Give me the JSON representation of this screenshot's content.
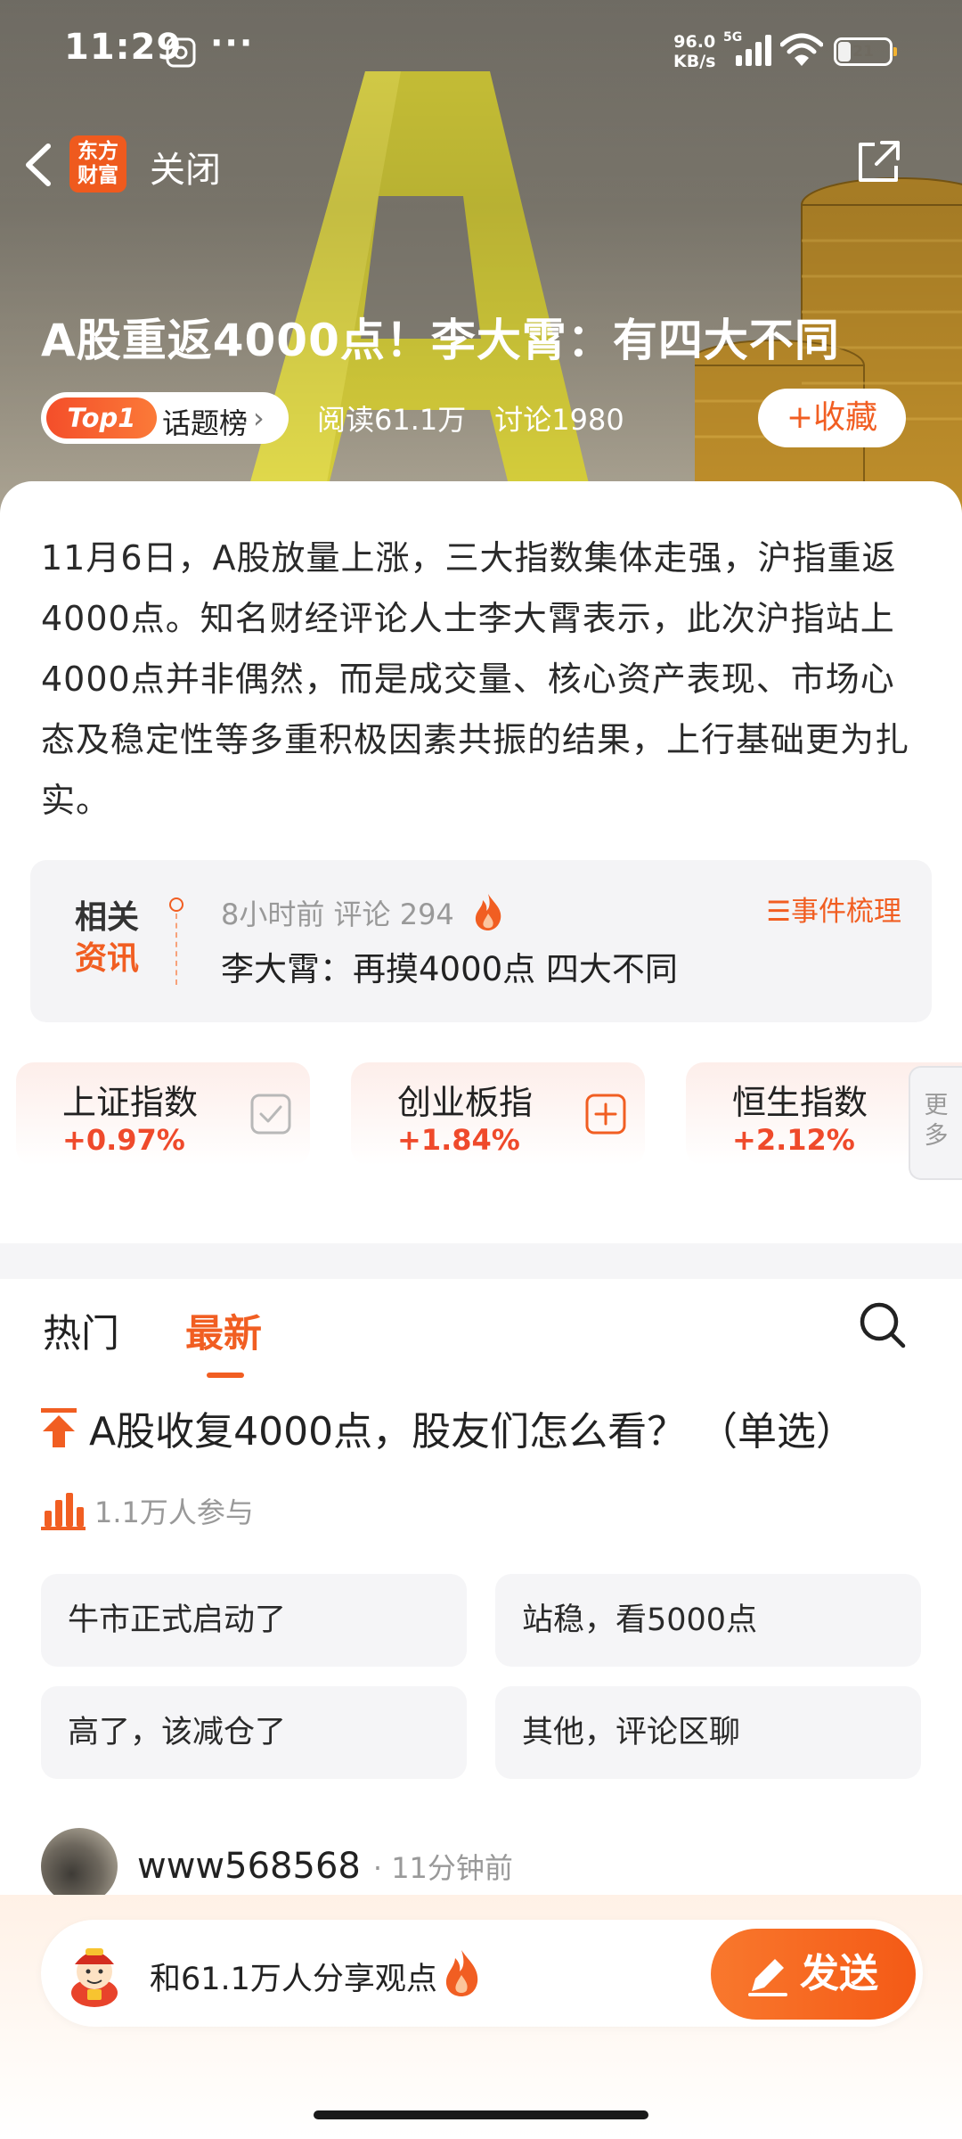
{
  "status_bar": {
    "time": "11:29",
    "dots": "···",
    "speed_value": "96.0",
    "speed_unit": "KB/s",
    "network": "5G",
    "battery": "21",
    "battery_level": 0.21
  },
  "nav": {
    "logo_line1": "东方",
    "logo_line2": "财富",
    "close_label": "关闭"
  },
  "hero": {
    "title": "A股重返4000点！李大霄：有四大不同",
    "badge": "Top1",
    "topic_label": "话题榜",
    "reads": "阅读61.1万",
    "discussions": "讨论1980",
    "collect_label": "+收藏"
  },
  "summary": "11月6日，A股放量上涨，三大指数集体走强，沪指重返4000点。知名财经评论人士李大霄表示，此次沪指站上4000点并非偶然，而是成交量、核心资产表现、市场心态及稳定性等多重积极因素共振的结果，上行基础更为扎实。",
  "related": {
    "tag_line1": "相关",
    "tag_line2": "资讯",
    "meta": "8小时前 评论 294",
    "title": "李大霄：再摸4000点 四大不同",
    "events_label": "☰事件梳理"
  },
  "indices": [
    {
      "name": "上证指数",
      "change": "+0.97%",
      "icon": "check-icon"
    },
    {
      "name": "创业板指",
      "change": "+1.84%",
      "icon": "plus-icon"
    },
    {
      "name": "恒生指数",
      "change": "+2.12%"
    }
  ],
  "more_label_1": "更",
  "more_label_2": "多",
  "tabs": [
    {
      "label": "热门"
    },
    {
      "label": "最新"
    }
  ],
  "poll": {
    "question": "A股收复4000点，股友们怎么看？ （单选）",
    "participants": "1.1万人参与",
    "options": [
      "牛市正式启动了",
      "站稳，看5000点",
      "高了，该减仓了",
      "其他，评论区聊"
    ]
  },
  "comment": {
    "user": "www568568",
    "time": "· 11分钟前"
  },
  "bottom": {
    "placeholder": "和61.1万人分享观点",
    "send_label": "发送"
  },
  "colors": {
    "accent": "#f15e22",
    "up": "#ef4a2b"
  }
}
